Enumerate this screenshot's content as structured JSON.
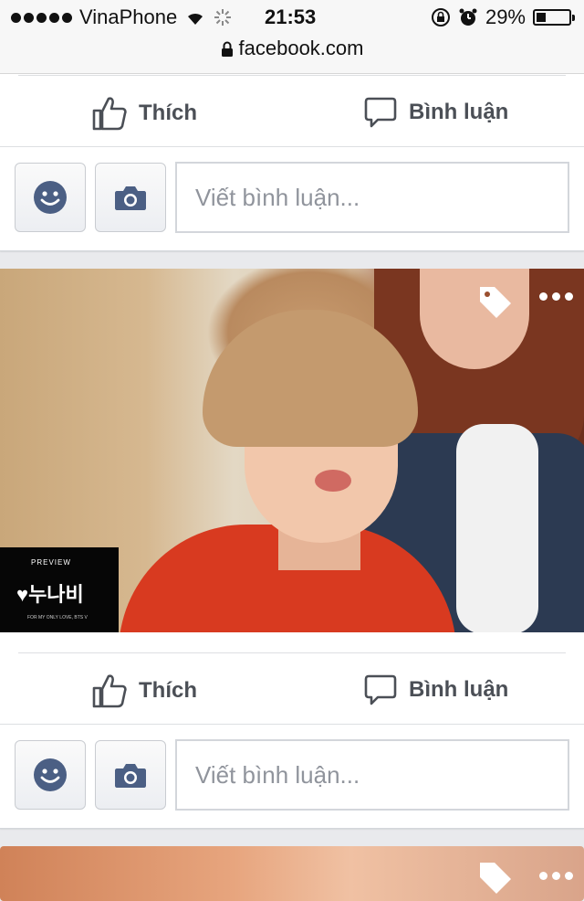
{
  "status_bar": {
    "carrier": "VinaPhone",
    "time": "21:53",
    "battery_percent": "29%",
    "battery_level": 0.29,
    "url": "facebook.com"
  },
  "post1": {
    "like_label": "Thích",
    "comment_label": "Bình luận",
    "comment_placeholder": "Viết bình luận..."
  },
  "post2": {
    "preview_label": "PREVIEW",
    "preview_title": "♥누나비",
    "preview_caption": "FOR MY ONLY LOVE, BTS V",
    "like_label": "Thích",
    "comment_label": "Bình luận",
    "comment_placeholder": "Viết bình luận..."
  },
  "icons": [
    "signal-dots-icon",
    "wifi-icon",
    "loading-spinner-icon",
    "rotation-lock-icon",
    "alarm-icon",
    "battery-icon",
    "lock-icon",
    "like-icon",
    "comment-icon",
    "emoji-icon",
    "camera-icon",
    "tag-icon",
    "more-icon"
  ],
  "colors": {
    "action_text": "#4b4f56",
    "icon_blue": "#4b5f84",
    "placeholder": "#90949c",
    "background": "#e9eaed"
  }
}
